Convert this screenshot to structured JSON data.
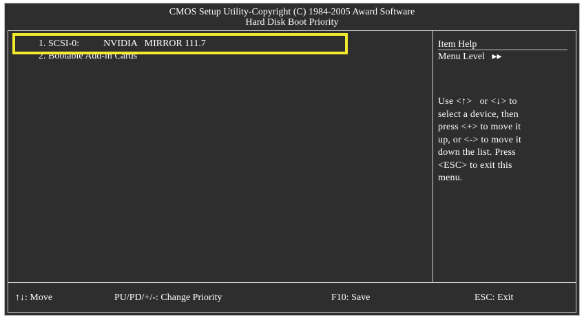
{
  "header": {
    "line1": "CMOS Setup Utility-Copyright (C) 1984-2005 Award Software",
    "line2": "Hard Disk Boot Priority"
  },
  "devices": [
    {
      "label": "1. SCSI-0:          NVIDIA   MIRROR 111.7"
    },
    {
      "label": "2. Bootable Add-in Cards"
    }
  ],
  "help": {
    "title": "Item Help",
    "menu_level": "Menu Level   ▸▸",
    "lines": [
      "Use <↑>   or <↓> to",
      "select a device, then",
      "press <+> to move it",
      "up, or <-> to move it",
      "down the list. Press",
      "<ESC> to exit this",
      "menu."
    ]
  },
  "footer": {
    "move": "↑↓: Move",
    "priority": "PU/PD/+/-: Change Priority",
    "save": "F10: Save",
    "exit": "ESC: Exit"
  },
  "colors": {
    "background": "#2e2e2e",
    "text": "#ffffff",
    "highlight": "#f2ea2a"
  }
}
